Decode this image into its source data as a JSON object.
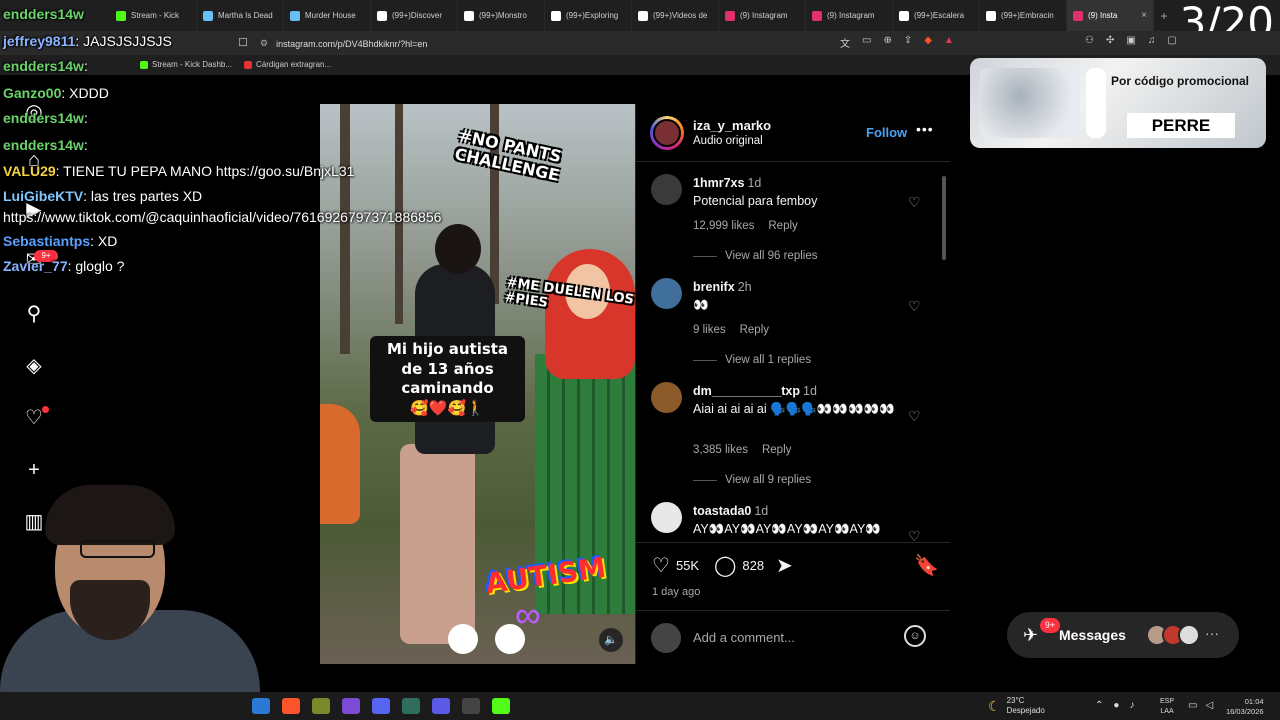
{
  "browser": {
    "tabs": [
      {
        "label": "Stream - Kick",
        "color": "#53fc18"
      },
      {
        "label": "Martha Is Dead",
        "color": "#66c0f4"
      },
      {
        "label": "Murder House",
        "color": "#66c0f4"
      },
      {
        "label": "(99+)Discover",
        "color": "#ffffff"
      },
      {
        "label": "(99+)Monstro",
        "color": "#ffffff"
      },
      {
        "label": "(99+)Exploring",
        "color": "#ffffff"
      },
      {
        "label": "(99+)Videos de",
        "color": "#ffffff"
      },
      {
        "label": "(9) Instagram",
        "color": "#e1306c"
      },
      {
        "label": "(9) Instagram",
        "color": "#e1306c"
      },
      {
        "label": "(99+)Escalera",
        "color": "#ffffff"
      },
      {
        "label": "(99+)Embracin",
        "color": "#ffffff"
      },
      {
        "label": "(9) Insta",
        "color": "#e1306c",
        "active": true
      }
    ],
    "new_tab": "+",
    "url": "instagram.com/p/DV4Bhdkiknr/?hl=en",
    "bookmarks": [
      {
        "label": "Stream - Kick Dashb...",
        "color": "#53fc18"
      },
      {
        "label": "Cárdigan extragran...",
        "color": "#e53238"
      }
    ]
  },
  "overlay": {
    "counter": "3/20"
  },
  "chat": [
    {
      "user": "endders14w",
      "text": "",
      "color": "#6ad36a"
    },
    {
      "user": "jeffrey9811",
      "text": ": JAJSJSJJSJS",
      "color": "#8ab4ff"
    },
    {
      "user": "endders14w",
      "text": ":",
      "color": "#6ad36a"
    },
    {
      "user": "Ganzo00",
      "text": ": XDDD",
      "color": "#6ad36a"
    },
    {
      "user": "endders14w",
      "text": ":",
      "color": "#6ad36a"
    },
    {
      "user": "endders14w",
      "text": ":",
      "color": "#6ad36a"
    },
    {
      "user": "VALU29",
      "text": ": TIENE TU PEPA MANO https://goo.su/BnjxL31",
      "color": "#f5d442"
    },
    {
      "user": "LuiGibeKTV",
      "text": ": las tres partes XD",
      "color": "#7ec8ff"
    },
    {
      "user": "",
      "text": "https://www.tiktok.com/@caquinhaoficial/video/7616926797371886856",
      "color": "#ffffff"
    },
    {
      "user": "Sebastiantps",
      "text": ": XD",
      "color": "#5aa0ff"
    },
    {
      "user": "Zavier_77",
      "text": ": gloglo ?",
      "color": "#8ab4ff"
    }
  ],
  "ig_nav": {
    "items": [
      "search-icon",
      "explore-icon",
      "notifications-icon",
      "create-icon",
      "dashboard-icon"
    ],
    "badge": "9+"
  },
  "post": {
    "username": "iza_y_marko",
    "subtitle": "Audio original",
    "follow_label": "Follow",
    "video_captions": {
      "top": "#NO PANTS CHALLENGE",
      "right": "#ME DUELEN LOS #PIES",
      "center": "Mi hijo autista de 13 años caminando",
      "center_emojis": "🥰❤️🥰🚶",
      "bottom": "AUTISM"
    },
    "comments": [
      {
        "user": "1hmr7xs",
        "time": "1d",
        "text": "Potencial para femboy",
        "likes": "12,999 likes",
        "reply": "Reply",
        "replies": "View all 96 replies",
        "avatar": "#3a3a3a"
      },
      {
        "user": "brenifx",
        "time": "2h",
        "text": "👀",
        "likes": "9 likes",
        "reply": "Reply",
        "replies": "View all 1 replies",
        "avatar": "#3f6f9a"
      },
      {
        "user": "dm__________txp",
        "time": "1d",
        "text": "Aiai ai ai ai ai 🗣️🗣️🗣️👀👀👀👀👀",
        "likes": "3,385 likes",
        "reply": "Reply",
        "replies": "View all 9 replies",
        "avatar": "#8a5a2a"
      },
      {
        "user": "toastada0",
        "time": "1d",
        "text": "AY👀AY👀AY👀AY👀AY👀AY👀",
        "likes": "",
        "reply": "",
        "replies": "",
        "avatar": "#e8e8e8"
      }
    ],
    "likes_count": "55K",
    "comments_count": "828",
    "posted": "1 day ago",
    "add_comment_placeholder": "Add a comment..."
  },
  "promo": {
    "text": "Por código promocional",
    "code": "PERRE"
  },
  "messages": {
    "label": "Messages",
    "badge": "9+"
  },
  "taskbar": {
    "temperature": "23°C",
    "weather": "Despejado",
    "lang_top": "ESP",
    "lang_bottom": "LAA",
    "time": "01:04",
    "date": "16/03/2026"
  }
}
